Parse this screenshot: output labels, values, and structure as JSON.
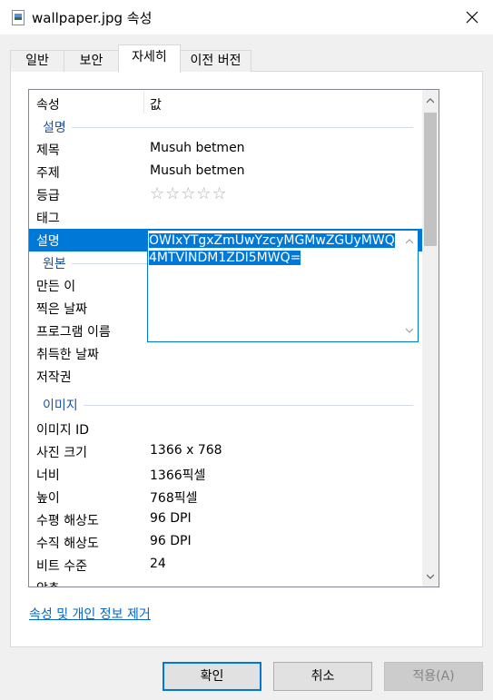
{
  "window": {
    "title": "wallpaper.jpg 속성",
    "close_icon": "close-icon"
  },
  "tabs": [
    {
      "label": "일반"
    },
    {
      "label": "보안"
    },
    {
      "label": "자세히",
      "active": true
    },
    {
      "label": "이전 버전"
    }
  ],
  "details": {
    "header": {
      "property": "속성",
      "value": "값"
    },
    "groups": {
      "description": "설명",
      "origin": "원본",
      "image": "이미지"
    },
    "rows": {
      "title": {
        "key": "제목",
        "value": "Musuh betmen"
      },
      "subject": {
        "key": "주제",
        "value": "Musuh betmen"
      },
      "rating": {
        "key": "등급",
        "stars": "☆☆☆☆☆",
        "value": 0
      },
      "tags": {
        "key": "태그"
      },
      "comment": {
        "key": "설명",
        "value": "OWIxYTgxZmUwYzcyMGMwZGUyMWQ4MTVlNDM1ZDI5MWQ="
      },
      "author": {
        "key": "만든 이"
      },
      "date_taken": {
        "key": "찍은 날짜"
      },
      "program": {
        "key": "프로그램 이름"
      },
      "date_acquired": {
        "key": "취득한 날짜"
      },
      "copyright": {
        "key": "저작권"
      },
      "image_id": {
        "key": "이미지 ID"
      },
      "dimensions": {
        "key": "사진 크기",
        "value": "1366 x 768"
      },
      "width": {
        "key": "너비",
        "value": "1366픽셀"
      },
      "height": {
        "key": "높이",
        "value": "768픽셀"
      },
      "hres": {
        "key": "수평 해상도",
        "value": "96 DPI"
      },
      "vres": {
        "key": "수직 해상도",
        "value": "96 DPI"
      },
      "bit_depth": {
        "key": "비트 수준",
        "value": "24"
      },
      "compression": {
        "key": "압축"
      }
    }
  },
  "remove_link": "속성 및 개인 정보 제거",
  "buttons": {
    "ok": "확인",
    "cancel": "취소",
    "apply": "적용(A)"
  },
  "colors": {
    "selection": "#0078d7",
    "link": "#0066cc",
    "group_label": "#1e50a0"
  }
}
